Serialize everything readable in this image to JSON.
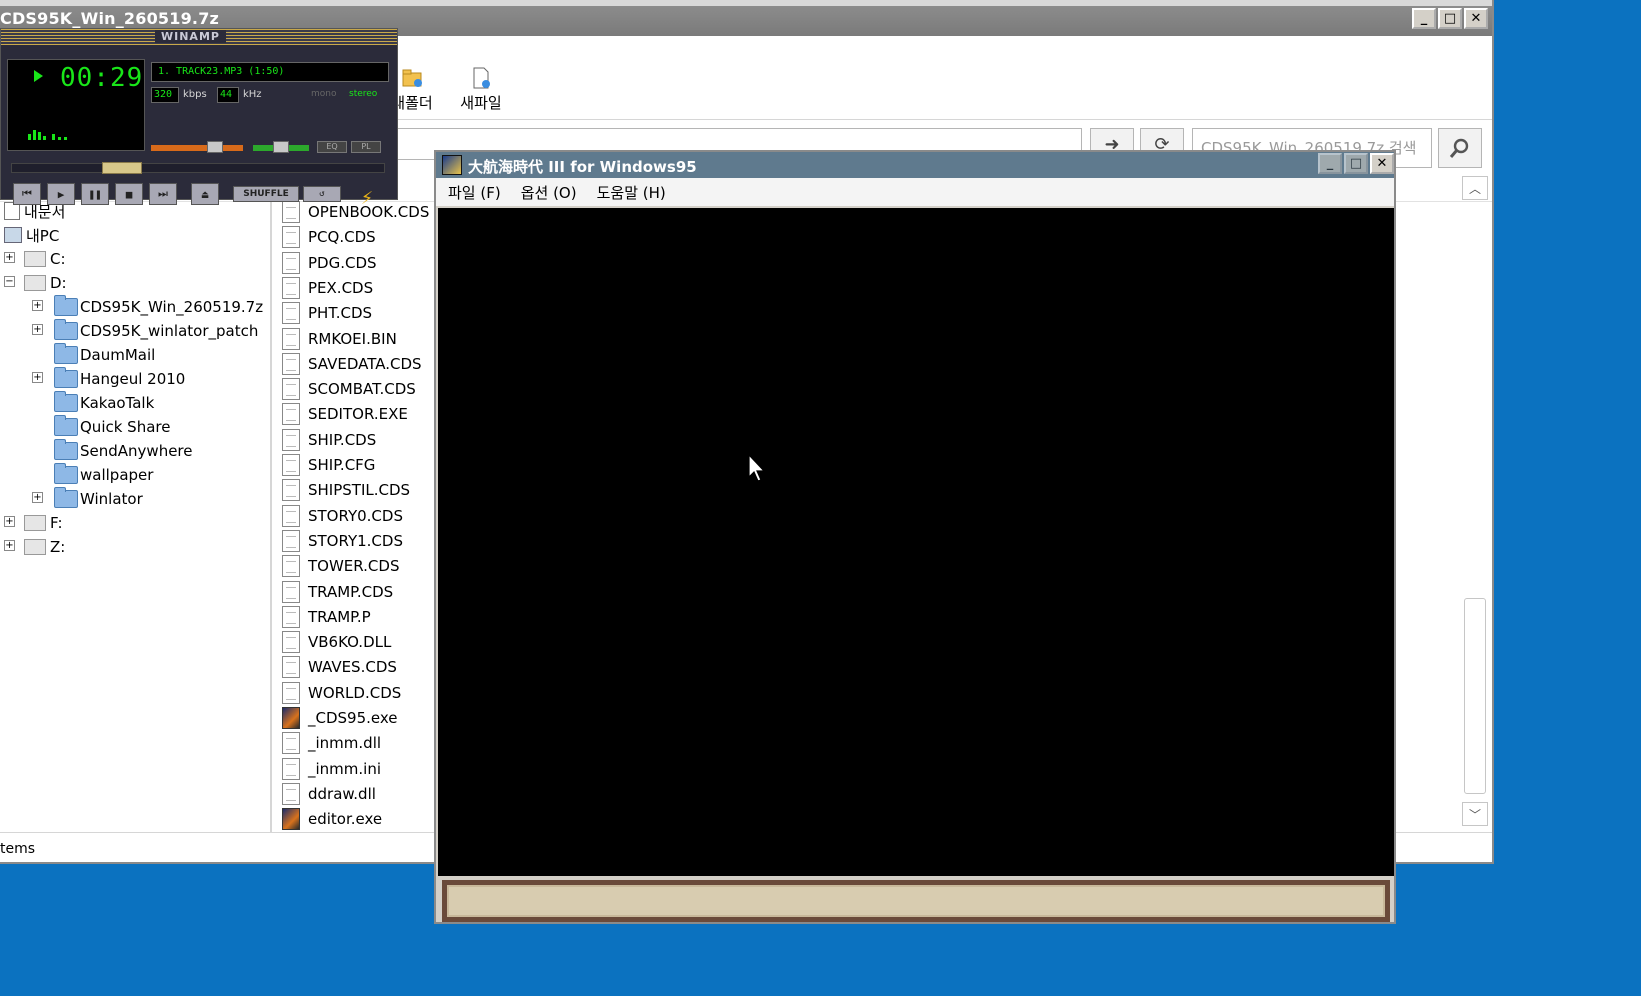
{
  "file_manager": {
    "title": "CDS95K_Win_260519.7z",
    "toolbar": {
      "new_folder_label": "새폴더",
      "new_file_label": "새파일"
    },
    "search_placeholder": "CDS95K_Win_260519.7z 검색",
    "tree": {
      "my_documents": "내문서",
      "my_pc": "내PC",
      "drives": [
        "C:",
        "D:",
        "F:",
        "Z:"
      ],
      "d_children": [
        "CDS95K_Win_260519.7z",
        "CDS95K_winlator_patch",
        "DaumMail",
        "Hangeul 2010",
        "KakaoTalk",
        "Quick Share",
        "SendAnywhere",
        "wallpaper",
        "Winlator"
      ]
    },
    "files": [
      "OPENBOOK.CDS",
      "PCQ.CDS",
      "PDG.CDS",
      "PEX.CDS",
      "PHT.CDS",
      "RMKOEI.BIN",
      "SAVEDATA.CDS",
      "SCOMBAT.CDS",
      "SEDITOR.EXE",
      "SHIP.CDS",
      "SHIP.CFG",
      "SHIPSTIL.CDS",
      "STORY0.CDS",
      "STORY1.CDS",
      "TOWER.CDS",
      "TRAMP.CDS",
      "TRAMP.P",
      "VB6KO.DLL",
      "WAVES.CDS",
      "WORLD.CDS",
      "_CDS95.exe",
      "_inmm.dll",
      "_inmm.ini",
      "ddraw.dll",
      "editor.exe"
    ],
    "status_text": "tems"
  },
  "winamp": {
    "title": "WINAMP",
    "time": "00:29",
    "track": "1. TRACK23.MP3 (1:50)",
    "kbps_value": "320",
    "kbps_label": "kbps",
    "khz_value": "44",
    "khz_label": "kHz",
    "mono_label": "mono",
    "stereo_label": "stereo",
    "eq_label": "EQ",
    "pl_label": "PL",
    "shuffle_label": "SHUFFLE",
    "seek_fraction": 0.27
  },
  "game": {
    "title": "大航海時代 III for Windows95",
    "menu": [
      "파일 (F)",
      "옵션 (O)",
      "도움말 (H)"
    ]
  },
  "colors": {
    "desktop": "#0b72c0",
    "winamp_green": "#19e619",
    "game_title": "#5f7a8e"
  }
}
